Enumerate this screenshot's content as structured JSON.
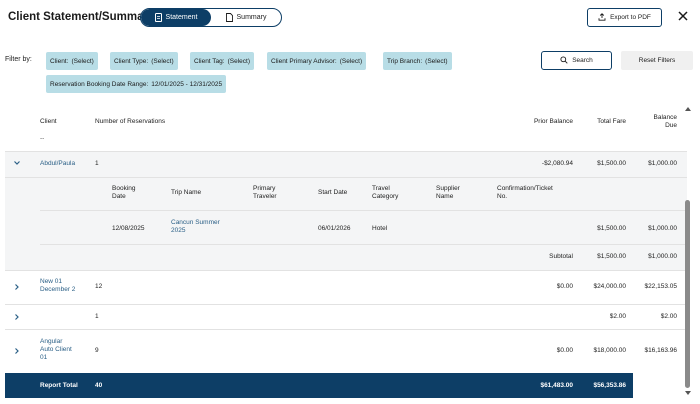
{
  "header": {
    "title": "Client Statement/Summary",
    "toggle_statement": "Statement",
    "toggle_summary": "Summary",
    "export_label": "Export to PDF"
  },
  "filters": {
    "label": "Filter by:",
    "client": {
      "key": "Client:",
      "value": "(Select)"
    },
    "client_type": {
      "key": "Client Type:",
      "value": "(Select)"
    },
    "client_tag": {
      "key": "Client Tag:",
      "value": "(Select)"
    },
    "primary_advisor": {
      "key": "Client Primary Advisor:",
      "value": "(Select)"
    },
    "trip_branch": {
      "key": "Trip Branch:",
      "value": "(Select)"
    },
    "date_range": {
      "key": "Reservation Booking Date Range:",
      "value": "12/01/2025 - 12/31/2025"
    },
    "search_label": "Search",
    "reset_label": "Reset Filters"
  },
  "table": {
    "columns": {
      "client": "Client",
      "reservations": "Number of Reservations",
      "prior_balance": "Prior Balance",
      "total_fare": "Total Fare",
      "balance_due_1": "Balance",
      "balance_due_2": "Due",
      "sort_marker": "--"
    },
    "rows": [
      {
        "client": "Abdul/Paula",
        "reservations": "1",
        "prior_balance": "-$2,080.94",
        "total_fare": "$1,500.00",
        "balance_due": "$1,000.00",
        "expanded": true
      },
      {
        "client_line1": "New 01",
        "client_line2": "December 2",
        "reservations": "12",
        "prior_balance": "$0.00",
        "total_fare": "$24,000.00",
        "balance_due": "$22,153.05"
      },
      {
        "client": "",
        "reservations": "1",
        "prior_balance": "",
        "total_fare": "$2.00",
        "balance_due": "$2.00"
      },
      {
        "client_line1": "Angular",
        "client_line2": "Auto Client",
        "client_line3": "01",
        "reservations": "9",
        "prior_balance": "$0.00",
        "total_fare": "$18,000.00",
        "balance_due": "$16,163.96"
      }
    ],
    "detail": {
      "columns": {
        "booking_date_1": "Booking",
        "booking_date_2": "Date",
        "trip_name": "Trip Name",
        "primary_traveler_1": "Primary",
        "primary_traveler_2": "Traveler",
        "start_date": "Start Date",
        "travel_category_1": "Travel",
        "travel_category_2": "Category",
        "supplier_name_1": "Supplier",
        "supplier_name_2": "Name",
        "confirmation_1": "Confirmation/Ticket",
        "confirmation_2": "No."
      },
      "row": {
        "booking_date": "12/08/2025",
        "trip_name_1": "Cancun Summer",
        "trip_name_2": "2025",
        "start_date": "06/01/2026",
        "travel_category": "Hotel",
        "total_fare": "$1,500.00",
        "balance_due": "$1,000.00"
      },
      "subtotal": {
        "label": "Subtotal",
        "total_fare": "$1,500.00",
        "balance_due": "$1,000.00"
      }
    },
    "total": {
      "label": "Report Total",
      "reservations": "40",
      "prior_balance": "$61,483.00",
      "total_fare": "$56,353.86"
    }
  },
  "colors": {
    "primary": "#0d3e66",
    "chip": "#b8dde6",
    "link": "#2a5f86"
  }
}
